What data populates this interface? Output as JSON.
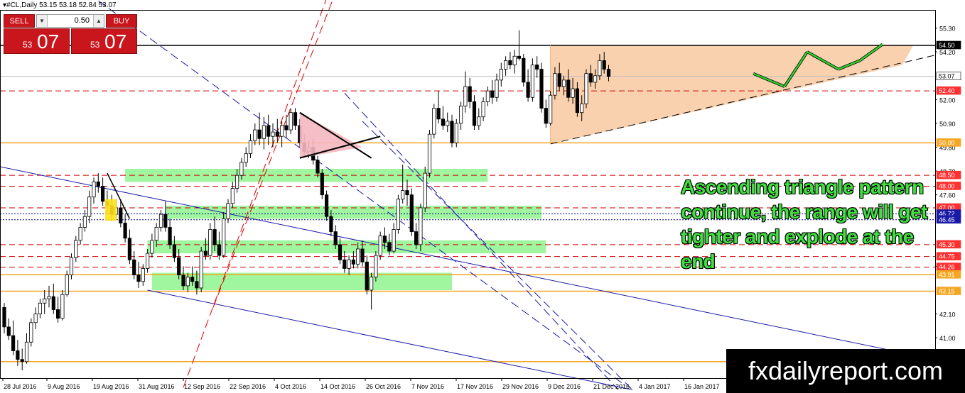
{
  "title": "▾#CL,Daily  53.15 53.18 52.84 53.07",
  "trade": {
    "sell_label": "SELL",
    "buy_label": "BUY",
    "lot_value": "0.50",
    "lot_down": "▼",
    "lot_up": "▲",
    "sell_small": "53",
    "sell_big": "07",
    "buy_small": "53",
    "buy_big": "07"
  },
  "annotation": "Ascending triangle pattern continue, the range will get tighter and explode at the end",
  "watermark": "fxdailyreport.com",
  "chart_data": {
    "type": "candlestick",
    "title": "#CL,Daily",
    "ylim": [
      39.4,
      56.4
    ],
    "x_ticks": [
      "28 Jul 2016",
      "9 Aug 2016",
      "19 Aug 2016",
      "31 Aug 2016",
      "12 Sep 2016",
      "22 Sep 2016",
      "4 Oct 2016",
      "14 Oct 2016",
      "26 Oct 2016",
      "7 Nov 2016",
      "17 Nov 2016",
      "29 Nov 2016",
      "9 Dec 2016",
      "21 Dec 2016",
      "4 Jan 2017",
      "16 Jan 2017"
    ],
    "y_ticks": [
      55.3,
      54.2,
      52.0,
      50.9,
      49.8,
      48.7,
      47.6,
      44.3,
      42.1,
      41.0,
      39.9
    ],
    "level_labels": [
      {
        "value": 54.5,
        "text": "54.50",
        "style": "black-box"
      },
      {
        "value": 53.07,
        "text": "53.07",
        "style": "current"
      },
      {
        "value": 52.4,
        "text": "52.40",
        "style": "red"
      },
      {
        "value": 50.0,
        "text": "50.00",
        "style": "orange"
      },
      {
        "value": 48.5,
        "text": "48.50",
        "style": "red"
      },
      {
        "value": 48.0,
        "text": "48.00",
        "style": "red"
      },
      {
        "value": 47.0,
        "text": "47.00",
        "style": "red"
      },
      {
        "value": 46.72,
        "text": "46.72",
        "style": "blue"
      },
      {
        "value": 46.45,
        "text": "46.45",
        "style": "blue"
      },
      {
        "value": 45.3,
        "text": "45.30",
        "style": "red"
      },
      {
        "value": 44.75,
        "text": "44.75",
        "style": "red"
      },
      {
        "value": 44.26,
        "text": "44.26",
        "style": "red"
      },
      {
        "value": 43.91,
        "text": "43.91",
        "style": "orange"
      },
      {
        "value": 43.15,
        "text": "43.15",
        "style": "orange"
      }
    ],
    "candles": [
      [
        42.4,
        42.6,
        41.2,
        41.5
      ],
      [
        41.5,
        41.9,
        40.9,
        41.1
      ],
      [
        41.1,
        41.8,
        40.2,
        40.4
      ],
      [
        40.4,
        40.9,
        39.7,
        40.0
      ],
      [
        40.0,
        40.5,
        39.5,
        39.9
      ],
      [
        39.9,
        41.2,
        39.8,
        40.8
      ],
      [
        40.8,
        41.9,
        40.6,
        41.7
      ],
      [
        41.7,
        42.4,
        41.4,
        42.1
      ],
      [
        42.1,
        42.8,
        41.9,
        42.6
      ],
      [
        42.6,
        43.2,
        42.1,
        42.8
      ],
      [
        42.8,
        43.4,
        42.4,
        42.9
      ],
      [
        42.9,
        43.5,
        42.1,
        42.3
      ],
      [
        42.3,
        42.9,
        41.7,
        41.9
      ],
      [
        41.9,
        43.2,
        41.8,
        43.0
      ],
      [
        43.0,
        44.1,
        42.9,
        43.9
      ],
      [
        43.9,
        44.9,
        43.7,
        44.7
      ],
      [
        44.7,
        45.7,
        44.5,
        45.5
      ],
      [
        45.5,
        46.3,
        45.3,
        46.1
      ],
      [
        46.1,
        46.9,
        45.9,
        46.6
      ],
      [
        46.6,
        47.8,
        46.3,
        47.5
      ],
      [
        47.5,
        48.4,
        47.2,
        48.2
      ],
      [
        48.2,
        48.6,
        47.7,
        48.0
      ],
      [
        48.0,
        48.4,
        47.1,
        47.3
      ],
      [
        47.3,
        47.8,
        46.7,
        47.1
      ],
      [
        47.1,
        47.6,
        46.4,
        46.7
      ],
      [
        46.7,
        47.4,
        46.5,
        47.0
      ],
      [
        47.0,
        47.4,
        46.1,
        46.3
      ],
      [
        46.3,
        46.7,
        45.4,
        45.6
      ],
      [
        45.6,
        46.0,
        44.4,
        44.6
      ],
      [
        44.6,
        45.0,
        43.7,
        43.9
      ],
      [
        43.9,
        44.5,
        43.3,
        43.6
      ],
      [
        43.6,
        44.4,
        43.4,
        44.2
      ],
      [
        44.2,
        45.1,
        44.0,
        44.9
      ],
      [
        44.9,
        45.8,
        44.7,
        45.5
      ],
      [
        45.5,
        46.3,
        45.2,
        46.1
      ],
      [
        46.1,
        46.9,
        45.9,
        46.7
      ],
      [
        46.7,
        47.3,
        45.9,
        46.1
      ],
      [
        46.1,
        46.5,
        45.1,
        45.3
      ],
      [
        45.3,
        45.7,
        44.5,
        44.7
      ],
      [
        44.7,
        45.1,
        43.7,
        43.9
      ],
      [
        43.9,
        44.3,
        43.2,
        43.4
      ],
      [
        43.4,
        44.0,
        43.1,
        43.8
      ],
      [
        43.8,
        44.3,
        43.4,
        43.6
      ],
      [
        43.6,
        44.1,
        43.0,
        43.3
      ],
      [
        43.3,
        45.2,
        43.1,
        45.0
      ],
      [
        45.0,
        45.6,
        44.6,
        44.8
      ],
      [
        44.8,
        46.3,
        44.6,
        46.0
      ],
      [
        46.0,
        46.6,
        45.0,
        45.3
      ],
      [
        45.3,
        45.9,
        44.6,
        44.8
      ],
      [
        44.8,
        46.8,
        44.7,
        46.5
      ],
      [
        46.5,
        47.4,
        46.3,
        47.2
      ],
      [
        47.2,
        48.2,
        47.0,
        47.9
      ],
      [
        47.9,
        48.8,
        47.7,
        48.5
      ],
      [
        48.5,
        49.3,
        48.3,
        49.1
      ],
      [
        49.1,
        49.8,
        48.9,
        49.5
      ],
      [
        49.5,
        50.4,
        49.3,
        50.1
      ],
      [
        50.1,
        50.9,
        49.9,
        50.6
      ],
      [
        50.6,
        51.4,
        49.9,
        50.2
      ],
      [
        50.2,
        51.2,
        49.7,
        50.8
      ],
      [
        50.8,
        51.3,
        49.9,
        50.3
      ],
      [
        50.3,
        50.9,
        49.8,
        50.5
      ],
      [
        50.5,
        51.1,
        50.0,
        50.3
      ],
      [
        50.3,
        51.0,
        49.8,
        50.8
      ],
      [
        50.8,
        51.3,
        50.2,
        50.6
      ],
      [
        50.6,
        51.6,
        50.4,
        51.4
      ],
      [
        51.4,
        51.6,
        50.6,
        50.8
      ],
      [
        50.8,
        51.1,
        49.8,
        50.0
      ],
      [
        50.0,
        50.4,
        49.4,
        49.6
      ],
      [
        49.6,
        50.1,
        49.3,
        49.8
      ],
      [
        49.8,
        50.2,
        49.0,
        49.2
      ],
      [
        49.2,
        49.4,
        48.4,
        48.6
      ],
      [
        48.6,
        48.8,
        47.4,
        47.6
      ],
      [
        47.6,
        47.8,
        46.4,
        46.6
      ],
      [
        46.6,
        46.9,
        45.7,
        45.9
      ],
      [
        45.9,
        46.2,
        45.1,
        45.3
      ],
      [
        45.3,
        45.6,
        44.4,
        44.6
      ],
      [
        44.6,
        45.0,
        44.0,
        44.2
      ],
      [
        44.2,
        44.8,
        43.9,
        44.6
      ],
      [
        44.6,
        45.0,
        44.2,
        44.4
      ],
      [
        44.4,
        45.4,
        44.2,
        45.1
      ],
      [
        45.1,
        45.5,
        44.3,
        44.5
      ],
      [
        44.5,
        44.8,
        43.0,
        43.2
      ],
      [
        43.2,
        44.0,
        42.3,
        43.8
      ],
      [
        43.8,
        45.0,
        43.6,
        44.8
      ],
      [
        44.8,
        45.9,
        44.6,
        45.7
      ],
      [
        45.7,
        46.1,
        45.1,
        45.4
      ],
      [
        45.4,
        45.8,
        44.8,
        45.0
      ],
      [
        45.0,
        46.3,
        44.9,
        46.0
      ],
      [
        46.0,
        47.6,
        45.8,
        47.4
      ],
      [
        47.4,
        49.0,
        47.2,
        47.8
      ],
      [
        47.8,
        48.3,
        47.1,
        47.6
      ],
      [
        47.6,
        47.9,
        45.7,
        45.9
      ],
      [
        45.9,
        46.3,
        45.1,
        45.3
      ],
      [
        45.3,
        47.2,
        45.0,
        47.0
      ],
      [
        47.0,
        48.9,
        46.8,
        48.6
      ],
      [
        48.6,
        50.6,
        48.4,
        50.4
      ],
      [
        50.4,
        51.8,
        50.2,
        51.6
      ],
      [
        51.6,
        52.4,
        50.9,
        51.1
      ],
      [
        51.1,
        51.7,
        50.6,
        50.8
      ],
      [
        50.8,
        51.4,
        50.5,
        51.0
      ],
      [
        51.0,
        51.3,
        49.8,
        50.0
      ],
      [
        50.0,
        51.1,
        49.8,
        50.9
      ],
      [
        50.9,
        51.9,
        50.6,
        51.7
      ],
      [
        51.7,
        53.3,
        51.4,
        52.6
      ],
      [
        52.6,
        53.0,
        51.6,
        51.9
      ],
      [
        51.9,
        52.2,
        50.6,
        50.8
      ],
      [
        50.8,
        51.6,
        50.6,
        51.2
      ],
      [
        51.2,
        52.1,
        51.0,
        51.9
      ],
      [
        51.9,
        52.6,
        51.7,
        52.4
      ],
      [
        52.4,
        52.9,
        51.8,
        52.1
      ],
      [
        52.1,
        53.2,
        51.9,
        52.9
      ],
      [
        52.9,
        53.7,
        52.6,
        53.4
      ],
      [
        53.4,
        54.0,
        53.1,
        53.8
      ],
      [
        53.8,
        54.2,
        53.4,
        53.6
      ],
      [
        53.6,
        54.3,
        53.2,
        54.0
      ],
      [
        54.0,
        55.2,
        53.8,
        53.9
      ],
      [
        53.9,
        54.1,
        52.6,
        52.8
      ],
      [
        52.8,
        53.4,
        51.9,
        52.1
      ],
      [
        52.1,
        53.9,
        51.9,
        53.6
      ],
      [
        53.6,
        54.0,
        53.0,
        53.4
      ],
      [
        53.4,
        53.7,
        51.4,
        51.6
      ],
      [
        51.6,
        52.0,
        50.7,
        50.9
      ],
      [
        50.9,
        52.4,
        50.8,
        52.2
      ],
      [
        52.2,
        53.5,
        52.0,
        53.2
      ],
      [
        53.2,
        53.7,
        52.4,
        52.6
      ],
      [
        52.6,
        53.1,
        52.2,
        52.9
      ],
      [
        52.9,
        53.4,
        51.9,
        52.1
      ],
      [
        52.1,
        53.0,
        51.8,
        52.5
      ],
      [
        52.5,
        52.8,
        51.2,
        51.4
      ],
      [
        51.4,
        52.2,
        51.0,
        51.8
      ],
      [
        51.8,
        53.4,
        51.6,
        53.2
      ],
      [
        53.2,
        53.6,
        52.6,
        52.8
      ],
      [
        52.8,
        53.4,
        52.5,
        53.1
      ],
      [
        53.1,
        54.1,
        52.9,
        53.8
      ],
      [
        53.8,
        54.2,
        53.2,
        53.4
      ],
      [
        53.4,
        53.6,
        52.84,
        53.07
      ]
    ]
  }
}
